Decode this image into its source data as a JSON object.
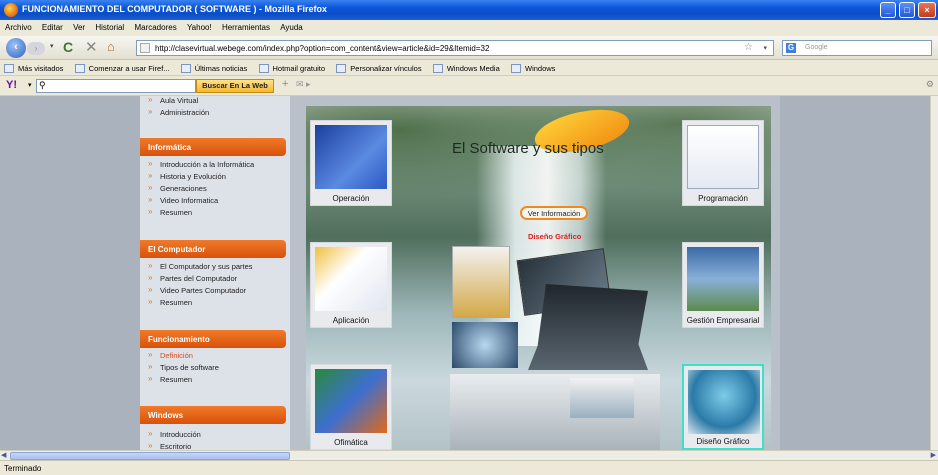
{
  "window": {
    "title": "FUNCIONAMIENTO DEL COMPUTADOR ( SOFTWARE ) - Mozilla Firefox",
    "controls": [
      "minimize",
      "maximize",
      "close"
    ]
  },
  "menu": [
    "Archivo",
    "Editar",
    "Ver",
    "Historial",
    "Marcadores",
    "Yahoo!",
    "Herramientas",
    "Ayuda"
  ],
  "nav": {
    "url": "http://clasevirtual.webege.com/index.php?option=com_content&view=article&id=29&Itemid=32",
    "search_placeholder": "Google"
  },
  "bookmarks": [
    "Más visitados",
    "Comenzar a usar Firef...",
    "Últimas noticias",
    "Hotmail gratuito",
    "Personalizar vínculos",
    "Windows Media",
    "Windows"
  ],
  "yahoo_toolbar": {
    "button": "Buscar En La Web"
  },
  "sidebar": {
    "top_items": [
      "Aula Virtual",
      "Administración"
    ],
    "sections": [
      {
        "title": "Informática",
        "items": [
          "Introducción a la Informática",
          "Historia y Evolución",
          "Generaciones",
          "Video Informatica",
          "Resumen"
        ]
      },
      {
        "title": "El Computador",
        "items": [
          "El Computador y sus partes",
          "Partes del Computador",
          "Video Partes Computador",
          "Resumen"
        ]
      },
      {
        "title": "Funcionamiento",
        "items": [
          "Definición",
          "Tipos de software",
          "Resumen"
        ]
      },
      {
        "title": "Windows",
        "items": [
          "Introducción",
          "Escritorio"
        ]
      }
    ]
  },
  "stage": {
    "title": "El Software y sus tipos",
    "ver_info": "Ver Información",
    "active_label": "Diseño Gráfico",
    "tiles": [
      "Operación",
      "Programación",
      "Aplicación",
      "Gestión Empresarial",
      "Ofimática",
      "Diseño Gráfico"
    ]
  },
  "status": "Terminado"
}
